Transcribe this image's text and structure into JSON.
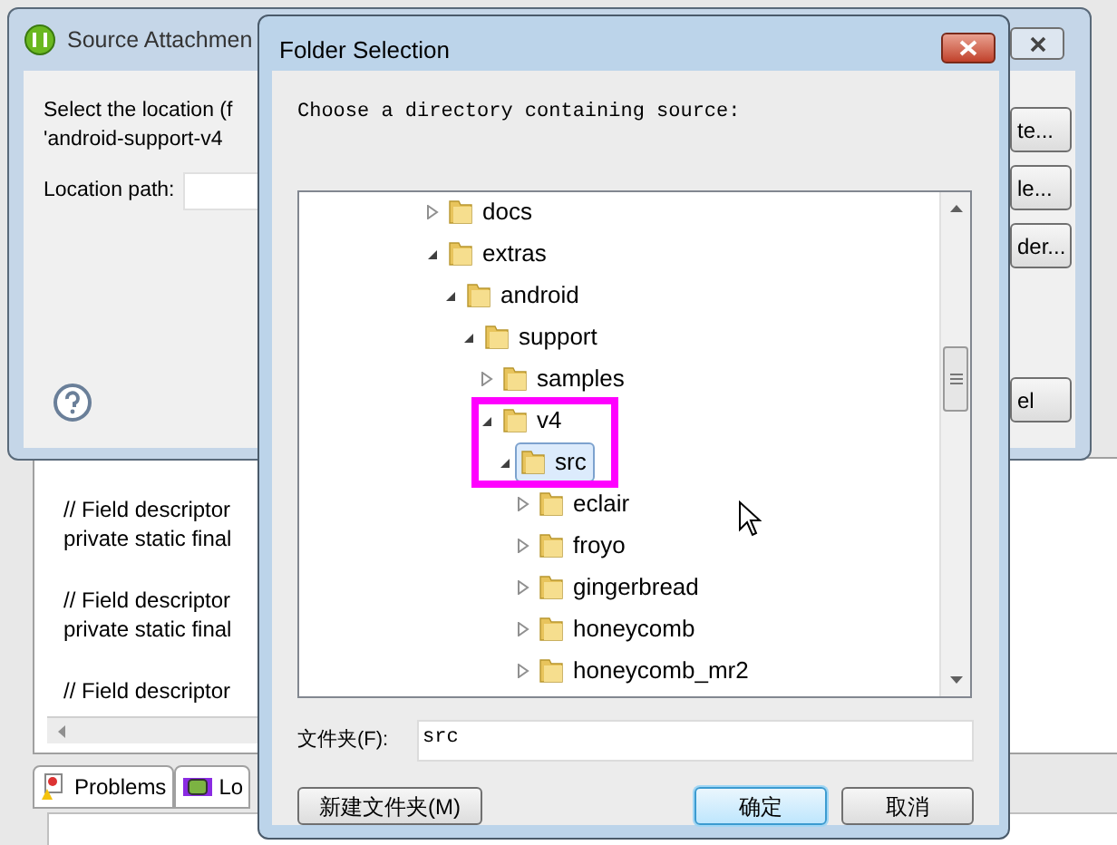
{
  "background_window": {
    "title": "Source Attachmen",
    "message_lines": [
      "Select the location (f",
      "'android-support-v4"
    ],
    "location_label": "Location path:",
    "buttons": [
      "te...",
      "le...",
      "der...",
      "el"
    ]
  },
  "editor": {
    "lines": [
      "// Field descriptor",
      "private static final",
      "// Field descriptor",
      "private static final",
      "// Field descriptor"
    ]
  },
  "bottom_tabs": [
    "Problems",
    "Lo"
  ],
  "dialog": {
    "title": "Folder Selection",
    "prompt": "Choose a directory containing source:",
    "tree": [
      {
        "label": "docs",
        "expanded": false,
        "selected": false
      },
      {
        "label": "extras",
        "expanded": true,
        "selected": false,
        "children": [
          {
            "label": "android",
            "expanded": true,
            "selected": false,
            "children": [
              {
                "label": "support",
                "expanded": true,
                "selected": false,
                "children": [
                  {
                    "label": "samples",
                    "expanded": false,
                    "selected": false
                  },
                  {
                    "label": "v4",
                    "expanded": true,
                    "selected": false,
                    "children": [
                      {
                        "label": "src",
                        "expanded": true,
                        "selected": true,
                        "children": [
                          {
                            "label": "eclair",
                            "expanded": false,
                            "selected": false
                          },
                          {
                            "label": "froyo",
                            "expanded": false,
                            "selected": false
                          },
                          {
                            "label": "gingerbread",
                            "expanded": false,
                            "selected": false
                          },
                          {
                            "label": "honeycomb",
                            "expanded": false,
                            "selected": false
                          },
                          {
                            "label": "honeycomb_mr2",
                            "expanded": false,
                            "selected": false
                          }
                        ]
                      }
                    ]
                  }
                ]
              }
            ]
          }
        ]
      }
    ],
    "folder_label": "文件夹(F):",
    "folder_value": "src",
    "buttons": [
      {
        "label": "新建文件夹(M)",
        "default": false
      },
      {
        "label": "确定",
        "default": true
      },
      {
        "label": "取消",
        "default": false
      }
    ]
  }
}
